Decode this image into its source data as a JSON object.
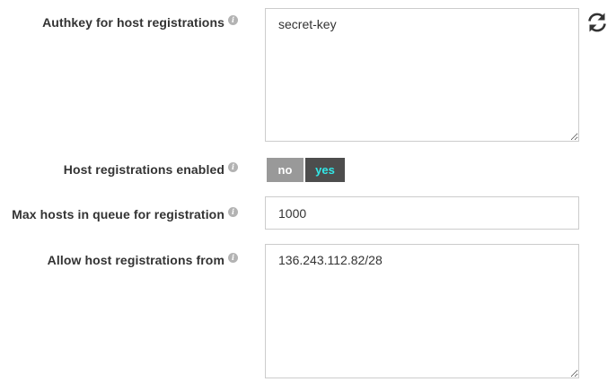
{
  "authkey": {
    "label": "Authkey for host registrations",
    "value": "secret-key"
  },
  "registrations_enabled": {
    "label": "Host registrations enabled",
    "options": [
      "no",
      "yes"
    ],
    "selected": "yes"
  },
  "max_hosts": {
    "label": "Max hosts in queue for registration",
    "value": "1000"
  },
  "allow_from": {
    "label": "Allow host registrations from",
    "value": "136.243.112.82/28"
  },
  "icons": {
    "info": "info-icon",
    "refresh": "refresh-icon",
    "info_glyph": "i"
  },
  "colors": {
    "toggle_off_bg": "#999999",
    "toggle_on_bg": "#4d4d4d",
    "toggle_on_text": "#32e8e8",
    "border": "#cccccc"
  }
}
